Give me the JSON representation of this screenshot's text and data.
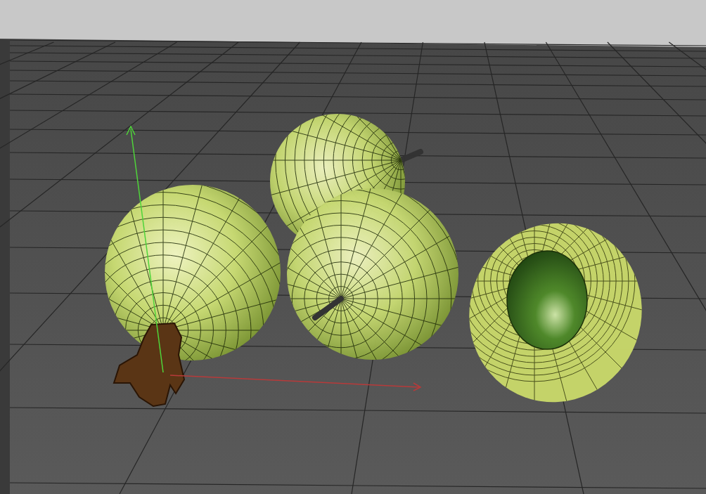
{
  "viewport": {
    "objects": [
      {
        "kind": "stem",
        "selected": false
      },
      {
        "kind": "root",
        "selected": true
      },
      {
        "kind": "stem",
        "selected": false
      },
      {
        "kind": "halved",
        "selected": false
      }
    ]
  }
}
